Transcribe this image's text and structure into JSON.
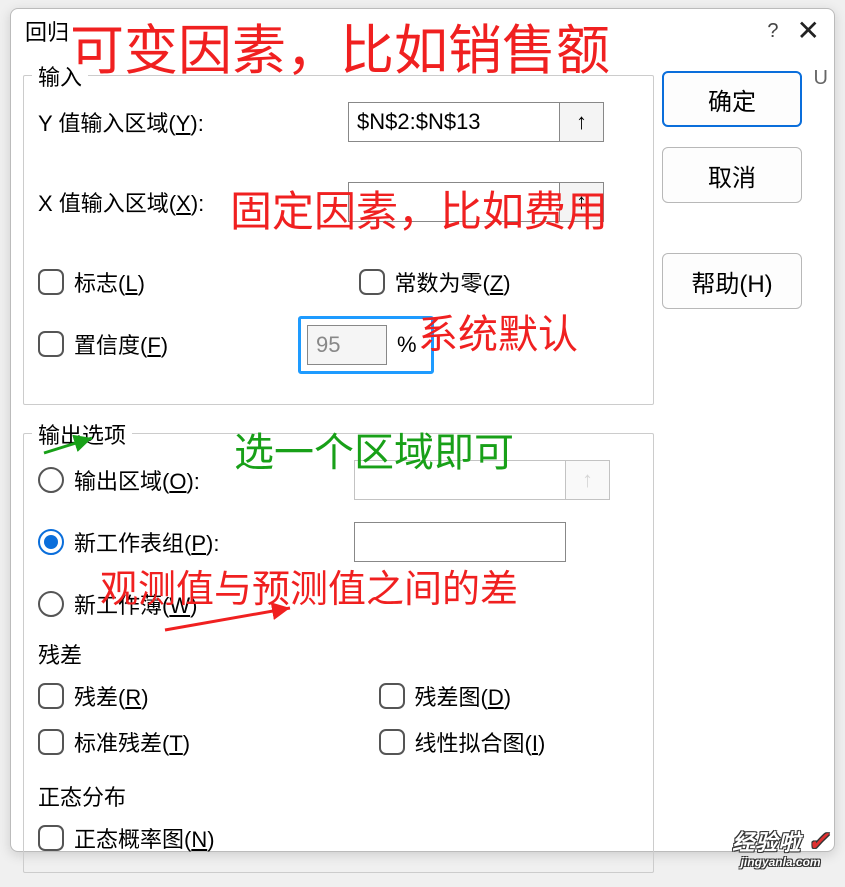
{
  "title": "回归",
  "buttons": {
    "ok": "确定",
    "cancel": "取消",
    "help": "帮助(H)"
  },
  "input": {
    "section": "输入",
    "y_label_pre": "Y 值输入区域(",
    "y_key": "Y",
    "y_label_post": "):",
    "y_value": "$N$2:$N$13",
    "x_label_pre": "X 值输入区域(",
    "x_key": "X",
    "x_label_post": "):",
    "x_value": "",
    "flag_pre": "标志(",
    "flag_key": "L",
    "flag_post": ")",
    "zero_pre": "常数为零(",
    "zero_key": "Z",
    "zero_post": ")",
    "conf_pre": "置信度(",
    "conf_key": "F",
    "conf_post": ")",
    "conf_value": "95",
    "pct": "%"
  },
  "output": {
    "section": "输出选项",
    "range_pre": "输出区域(",
    "range_key": "O",
    "range_post": "):",
    "range_value": "",
    "sheet_pre": "新工作表组(",
    "sheet_key": "P",
    "sheet_post": "):",
    "sheet_value": "",
    "book_pre": "新工作薄(",
    "book_key": "W",
    "book_post": ")",
    "resid_title": "残差",
    "resid_pre": "残差(",
    "resid_key": "R",
    "resid_post": ")",
    "residplot_pre": "残差图(",
    "residplot_key": "D",
    "residplot_post": ")",
    "std_pre": "标准残差(",
    "std_key": "T",
    "std_post": ")",
    "line_pre": "线性拟合图(",
    "line_key": "I",
    "line_post": ")",
    "norm_title": "正态分布",
    "norm_pre": "正态概率图(",
    "norm_key": "N",
    "norm_post": ")"
  },
  "annotations": {
    "a1": "可变因素，比如销售额",
    "a2": "固定因素，比如费用",
    "a3": "系统默认",
    "a4": "选一个区域即可",
    "a5": "观测值与预测值之间的差"
  },
  "misc": {
    "col": "U",
    "arrow": "↑",
    "help_q": "?",
    "close": "✕"
  },
  "watermark": {
    "big": "经验啦",
    "small": "jingyanla.com",
    "check": "✓"
  }
}
